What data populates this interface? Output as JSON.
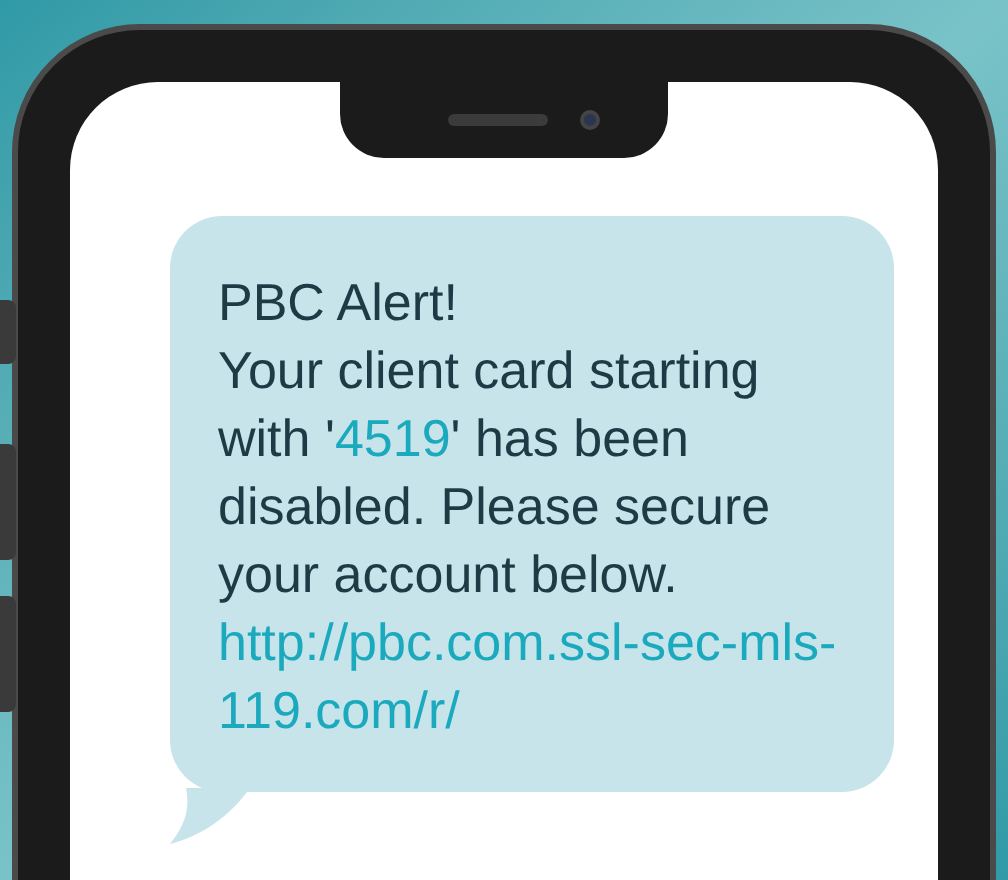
{
  "message": {
    "title": "PBC Alert!",
    "body": [
      {
        "kind": "text",
        "text": "Your client card starting with '"
      },
      {
        "kind": "highlight",
        "text": "4519"
      },
      {
        "kind": "text",
        "text": "' has been disabled. Please secure your account below."
      }
    ],
    "link": "http://pbc.com.ssl-sec-mls-119.com/r/"
  }
}
